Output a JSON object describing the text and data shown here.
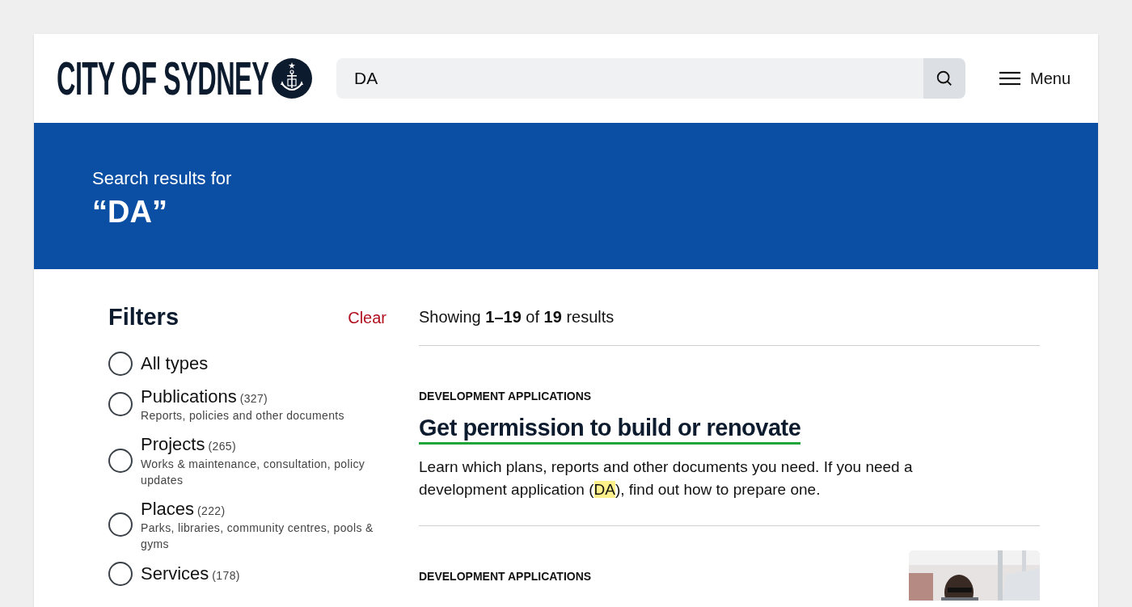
{
  "header": {
    "logo_text": "CITY OF SYDNEY",
    "search": {
      "value": "DA"
    },
    "menu_label": "Menu"
  },
  "banner": {
    "intro": "Search results for",
    "query": "“DA”"
  },
  "filters": {
    "title": "Filters",
    "clear": "Clear",
    "options": [
      {
        "label": "All types",
        "selected": false
      },
      {
        "label": "Publications",
        "count": "(327)",
        "description": "Reports, policies and other documents",
        "selected": false
      },
      {
        "label": "Projects",
        "count": "(265)",
        "description": "Works & maintenance, consultation, policy updates",
        "selected": false
      },
      {
        "label": "Places",
        "count": "(222)",
        "description": "Parks, libraries, community centres, pools & gyms",
        "selected": false
      },
      {
        "label": "Services",
        "count": "(178)",
        "selected": false
      }
    ]
  },
  "results": {
    "summary": "Showing **1–19** of **19** results",
    "items": [
      {
        "category": "DEVELOPMENT APPLICATIONS",
        "title": "Get permission to build or renovate",
        "description": [
          {
            "text": "Learn which plans, reports and other documents you need. If you need a development application (",
            "highlight": false
          },
          {
            "text": "DA",
            "highlight": true
          },
          {
            "text": "), find out how to prepare one.",
            "highlight": false
          }
        ],
        "image": false
      },
      {
        "category": "DEVELOPMENT APPLICATIONS",
        "image": true
      }
    ]
  }
}
